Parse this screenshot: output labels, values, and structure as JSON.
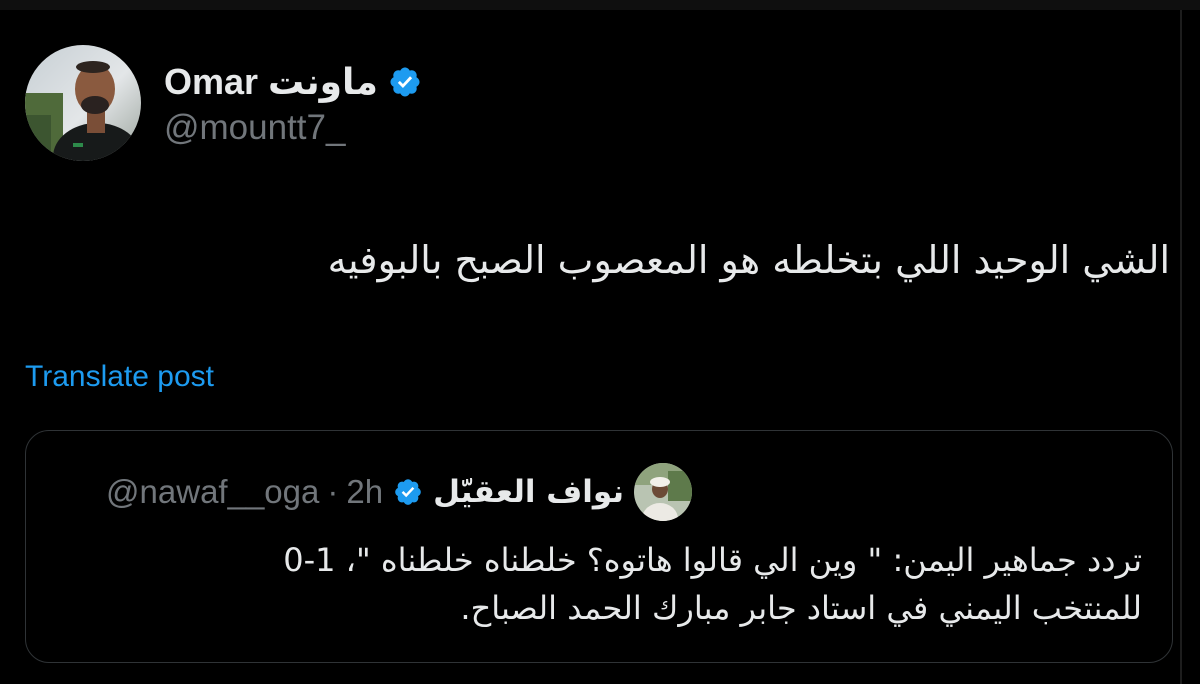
{
  "colors": {
    "background": "#000000",
    "text_primary": "#e7e9ea",
    "text_secondary": "#71767b",
    "link": "#1d9bf0",
    "verified_badge": "#1d9bf0",
    "border": "#2f3336"
  },
  "author": {
    "display_name": "Omar ماونت",
    "handle": "@mountt7_",
    "verified": true,
    "avatar_icon": "profile-photo"
  },
  "post": {
    "text": "الشي الوحيد اللي بتخلطه هو المعصوب الصبح بالبوفيه"
  },
  "translate": {
    "label": "Translate post"
  },
  "quoted_post": {
    "display_name": "نواف العقيّل",
    "handle": "@nawaf__oga",
    "separator": "·",
    "time": "2h",
    "verified": true,
    "text_lines": [
      "تردد جماهير اليمن: \" وين الي قالوا هاتوه؟ خلطناه خلطناه \"، 1-0",
      "للمنتخب اليمني في استاد جابر مبارك الحمد الصباح."
    ]
  }
}
